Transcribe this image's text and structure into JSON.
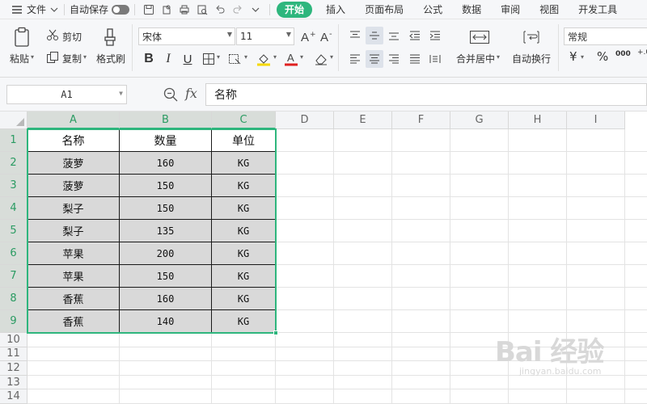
{
  "menubar": {
    "file": "文件",
    "autosave": "自动保存",
    "tabs": [
      "开始",
      "插入",
      "页面布局",
      "公式",
      "数据",
      "审阅",
      "视图",
      "开发工具"
    ]
  },
  "ribbon": {
    "paste": "粘贴",
    "cut": "剪切",
    "copy": "复制",
    "format_painter": "格式刷",
    "font_name": "宋体",
    "font_size": "11",
    "merge_center": "合并居中",
    "wrap_text": "自动换行",
    "number_format": "常规",
    "currency_symbol": "¥",
    "percent_symbol": "%",
    "thousands_symbol": "000",
    "font_color": "#e02020",
    "fill_color": "#f5d800"
  },
  "formula_bar": {
    "cell_ref": "A1",
    "fx": "fx",
    "content": "名称"
  },
  "sheet": {
    "columns": [
      "A",
      "B",
      "C",
      "D",
      "E",
      "F",
      "G",
      "H",
      "I"
    ],
    "rows": [
      "1",
      "2",
      "3",
      "4",
      "5",
      "6",
      "7",
      "8",
      "9",
      "10",
      "11",
      "12",
      "13",
      "14"
    ],
    "table": {
      "headers": [
        "名称",
        "数量",
        "单位"
      ],
      "data": [
        [
          "菠萝",
          "160",
          "KG"
        ],
        [
          "菠萝",
          "150",
          "KG"
        ],
        [
          "梨子",
          "150",
          "KG"
        ],
        [
          "梨子",
          "135",
          "KG"
        ],
        [
          "苹果",
          "200",
          "KG"
        ],
        [
          "苹果",
          "150",
          "KG"
        ],
        [
          "香蕉",
          "160",
          "KG"
        ],
        [
          "香蕉",
          "140",
          "KG"
        ]
      ]
    }
  },
  "accent_color": "#2eb67d",
  "watermark": {
    "brand": "Bai 经验",
    "url": "jingyan.baidu.com"
  }
}
